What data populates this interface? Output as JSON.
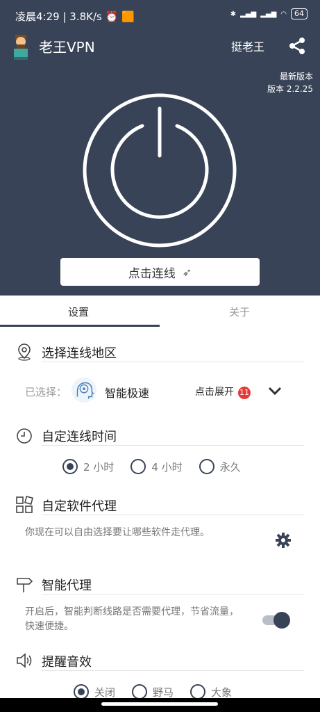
{
  "status": {
    "time": "凌晨4:29",
    "speed": "3.8K/s",
    "battery": "64"
  },
  "appbar": {
    "title": "老王VPN",
    "right_label": "挺老王"
  },
  "version": {
    "latest_label": "最新版本",
    "version_text": "版本 2.2.25"
  },
  "connect": {
    "label": "点击连线"
  },
  "tabs": {
    "settings": "设置",
    "about": "关于"
  },
  "region": {
    "title": "选择连线地区",
    "selected_label": "已选择：",
    "selected_value": "智能极速",
    "expand_label": "点击展开",
    "count": "11"
  },
  "connect_time": {
    "title": "自定连线时间",
    "options": [
      "2 小时",
      "4 小时",
      "永久"
    ],
    "selected": "2 小时"
  },
  "software_proxy": {
    "title": "自定软件代理",
    "desc": "你现在可以自由选择要让哪些软件走代理。"
  },
  "smart_proxy": {
    "title": "智能代理",
    "desc": "开启后，智能判断线路是否需要代理，节省流量，快速便捷。",
    "enabled": true
  },
  "sound": {
    "title": "提醒音效",
    "options": [
      "关闭",
      "野马",
      "大象"
    ],
    "selected": "关闭"
  },
  "colors": {
    "header_bg": "#384357",
    "accent": "#384357",
    "badge": "#e53935"
  }
}
